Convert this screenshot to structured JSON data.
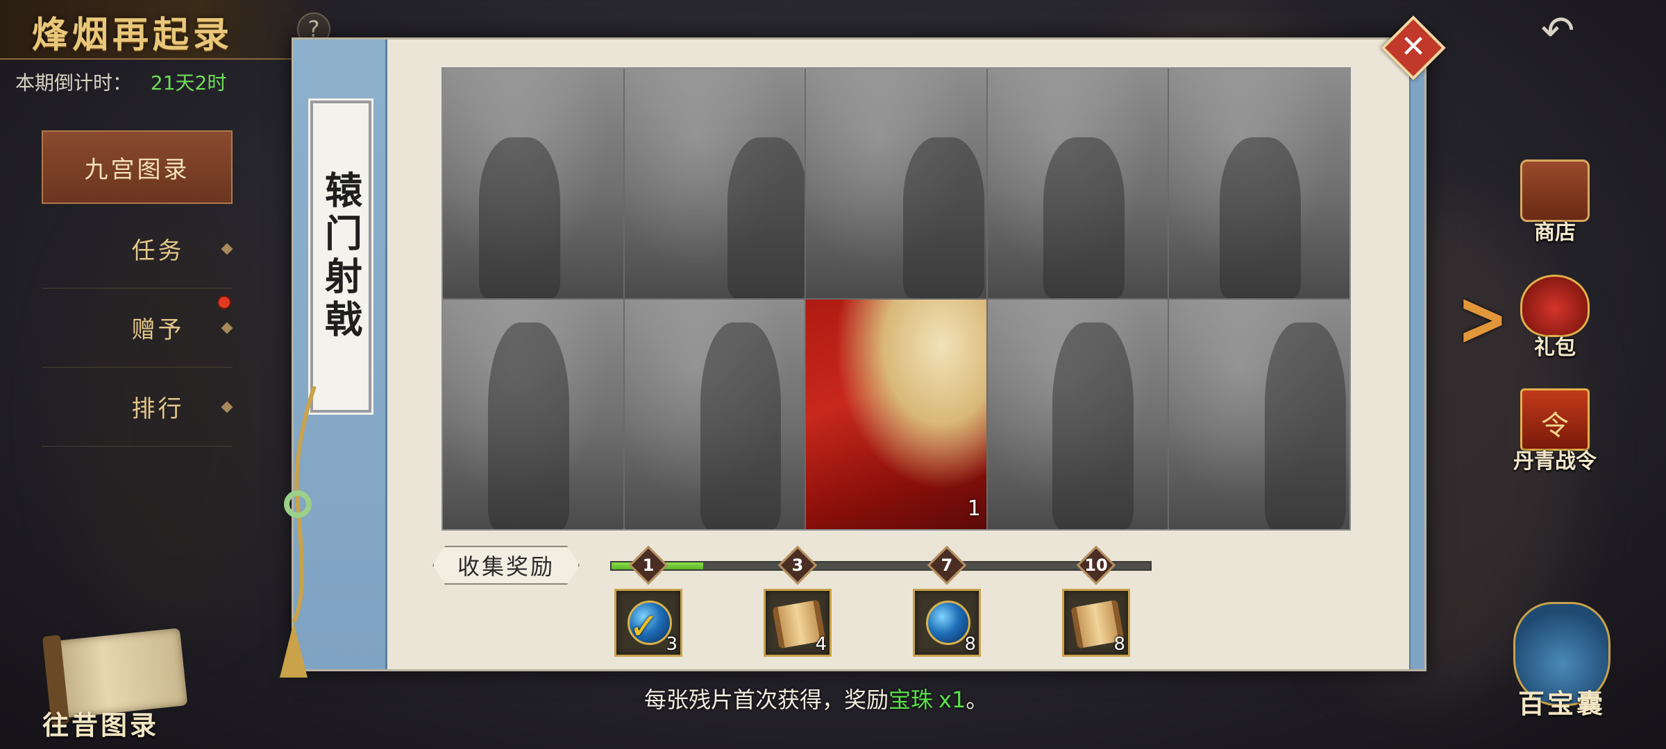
{
  "header": {
    "title": "烽烟再起录",
    "help_glyph": "?",
    "countdown_label": "本期倒计时：",
    "countdown_value": "21天2时",
    "back_glyph": "↶"
  },
  "nav": {
    "items": [
      {
        "label": "九宫图录",
        "active": true
      },
      {
        "label": "任务",
        "active": false
      },
      {
        "label": "赠予",
        "active": false,
        "badge": true
      },
      {
        "label": "排行",
        "active": false
      }
    ],
    "archive_label": "往昔图录"
  },
  "panel": {
    "card_name": "辕门射戟",
    "close_glyph": "✕",
    "pieces": [
      {
        "unlocked": false,
        "count": ""
      },
      {
        "unlocked": false,
        "count": ""
      },
      {
        "unlocked": false,
        "count": ""
      },
      {
        "unlocked": false,
        "count": ""
      },
      {
        "unlocked": false,
        "count": ""
      },
      {
        "unlocked": false,
        "count": ""
      },
      {
        "unlocked": false,
        "count": ""
      },
      {
        "unlocked": true,
        "count": "1"
      },
      {
        "unlocked": false,
        "count": ""
      },
      {
        "unlocked": false,
        "count": ""
      }
    ],
    "reward_label": "收集奖励",
    "progress_fraction": 0.17,
    "milestones": [
      {
        "num": "1",
        "item": "orb",
        "qty": "3",
        "claimed": true
      },
      {
        "num": "3",
        "item": "scroll",
        "qty": "4",
        "claimed": false
      },
      {
        "num": "7",
        "item": "orb",
        "qty": "8",
        "claimed": false
      },
      {
        "num": "10",
        "item": "scroll",
        "qty": "8",
        "claimed": false
      }
    ]
  },
  "side_menu": {
    "shop_label": "商店",
    "gift_label": "礼包",
    "pass_label": "丹青战令",
    "pass_char": "令",
    "toggle_glyph": ">",
    "treasure_label": "百宝囊"
  },
  "footer": {
    "note_prefix": "每张残片首次获得，奖励",
    "note_item": "宝珠",
    "note_qty": "x1",
    "note_suffix": "。"
  },
  "colors": {
    "accent_gold": "#e9c77a",
    "countdown_green": "#6fdc5a",
    "progress_green": "#5bb52a",
    "close_red": "#c0392b",
    "strip_blue": "#7fa3c2"
  }
}
